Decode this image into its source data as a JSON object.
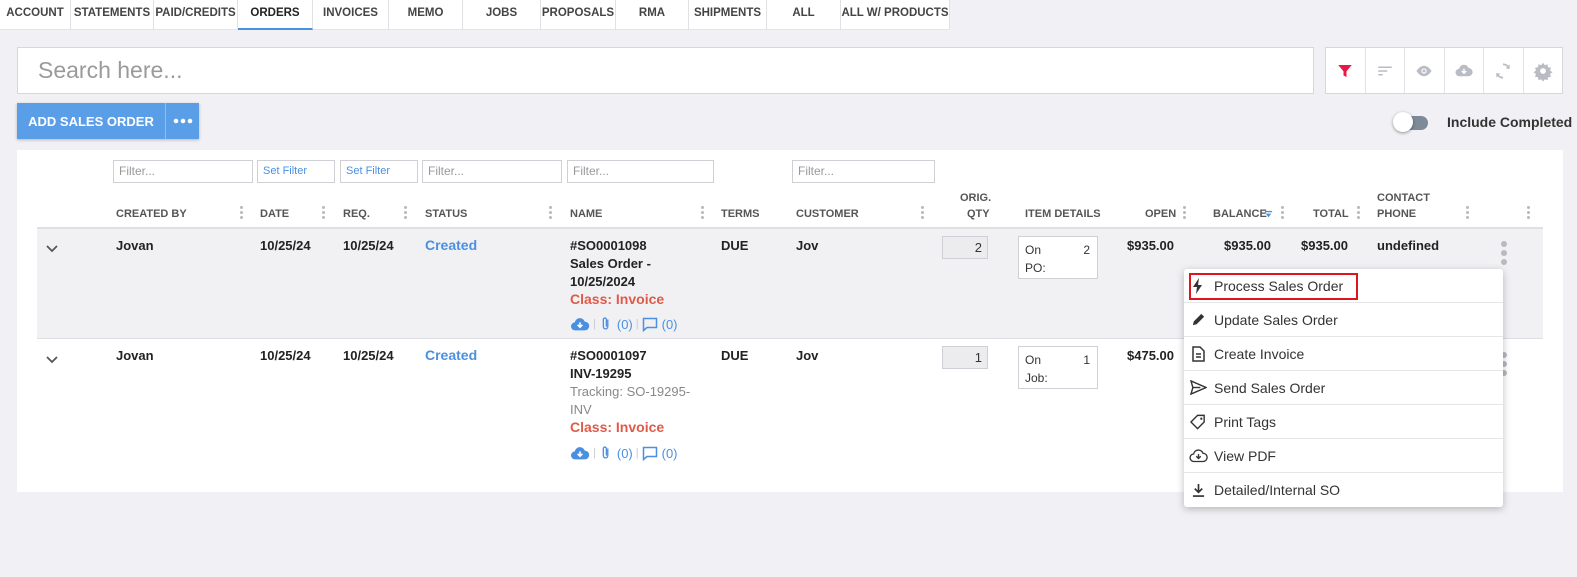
{
  "tabs": [
    "ACCOUNT",
    "STATEMENTS",
    "PAID/CREDITS",
    "ORDERS",
    "INVOICES",
    "MEMO",
    "JOBS",
    "PROPOSALS",
    "RMA",
    "SHIPMENTS",
    "ALL",
    "ALL W/ PRODUCTS"
  ],
  "active_tab": "ORDERS",
  "search": {
    "placeholder": "Search here..."
  },
  "toolbar": {
    "icons": [
      "filter-icon",
      "sort-icon",
      "eye-icon",
      "cloud-download-icon",
      "refresh-icon",
      "gear-icon"
    ],
    "filter_color": "#e8194a"
  },
  "add_button": {
    "label": "ADD SALES ORDER"
  },
  "include_completed": {
    "label": "Include Completed",
    "on": false
  },
  "filters": {
    "placeholder": "Filter...",
    "set_filter": "Set Filter"
  },
  "columns": {
    "created_by": "CREATED BY",
    "date": "DATE",
    "req": "REQ.",
    "status": "STATUS",
    "name": "NAME",
    "terms": "TERMS",
    "customer": "CUSTOMER",
    "orig_qty_1": "ORIG.",
    "orig_qty_2": "QTY",
    "item_details": "ITEM DETAILS",
    "open": "OPEN",
    "balance": "BALANCE",
    "total": "TOTAL",
    "contact_1": "CONTACT",
    "contact_2": "PHONE"
  },
  "rows": [
    {
      "created_by": "Jovan",
      "date": "10/25/24",
      "req": "10/25/24",
      "status": "Created",
      "so": "#SO0001098",
      "name_line1": "Sales Order -",
      "name_line2": "10/25/2024",
      "class": "Class: Invoice",
      "terms": "DUE",
      "customer": "Jov",
      "qty": "2",
      "item_label": "On",
      "item_count": "2",
      "item_sub": "PO:",
      "open": "$935.00",
      "balance": "$935.00",
      "total": "$935.00",
      "contact": "undefined",
      "attachments": "(0)",
      "comments": "(0)"
    },
    {
      "created_by": "Jovan",
      "date": "10/25/24",
      "req": "10/25/24",
      "status": "Created",
      "so": "#SO0001097",
      "name_line1": "INV-19295",
      "tracking_1": "Tracking: SO-19295-",
      "tracking_2": "INV",
      "class": "Class: Invoice",
      "terms": "DUE",
      "customer": "Jov",
      "qty": "1",
      "item_label": "On",
      "item_count": "1",
      "item_sub": "Job:",
      "open": "$475.00",
      "attachments": "(0)",
      "comments": "(0)"
    }
  ],
  "context_menu": [
    {
      "label": "Process Sales Order",
      "icon": "bolt-icon"
    },
    {
      "label": "Update Sales Order",
      "icon": "pencil-icon"
    },
    {
      "label": "Create Invoice",
      "icon": "document-icon"
    },
    {
      "label": "Send Sales Order",
      "icon": "send-icon"
    },
    {
      "label": "Print Tags",
      "icon": "tags-icon"
    },
    {
      "label": "View PDF",
      "icon": "cloud-download-icon"
    },
    {
      "label": "Detailed/Internal SO",
      "icon": "download-icon"
    }
  ],
  "highlight_color": "#e0141e"
}
